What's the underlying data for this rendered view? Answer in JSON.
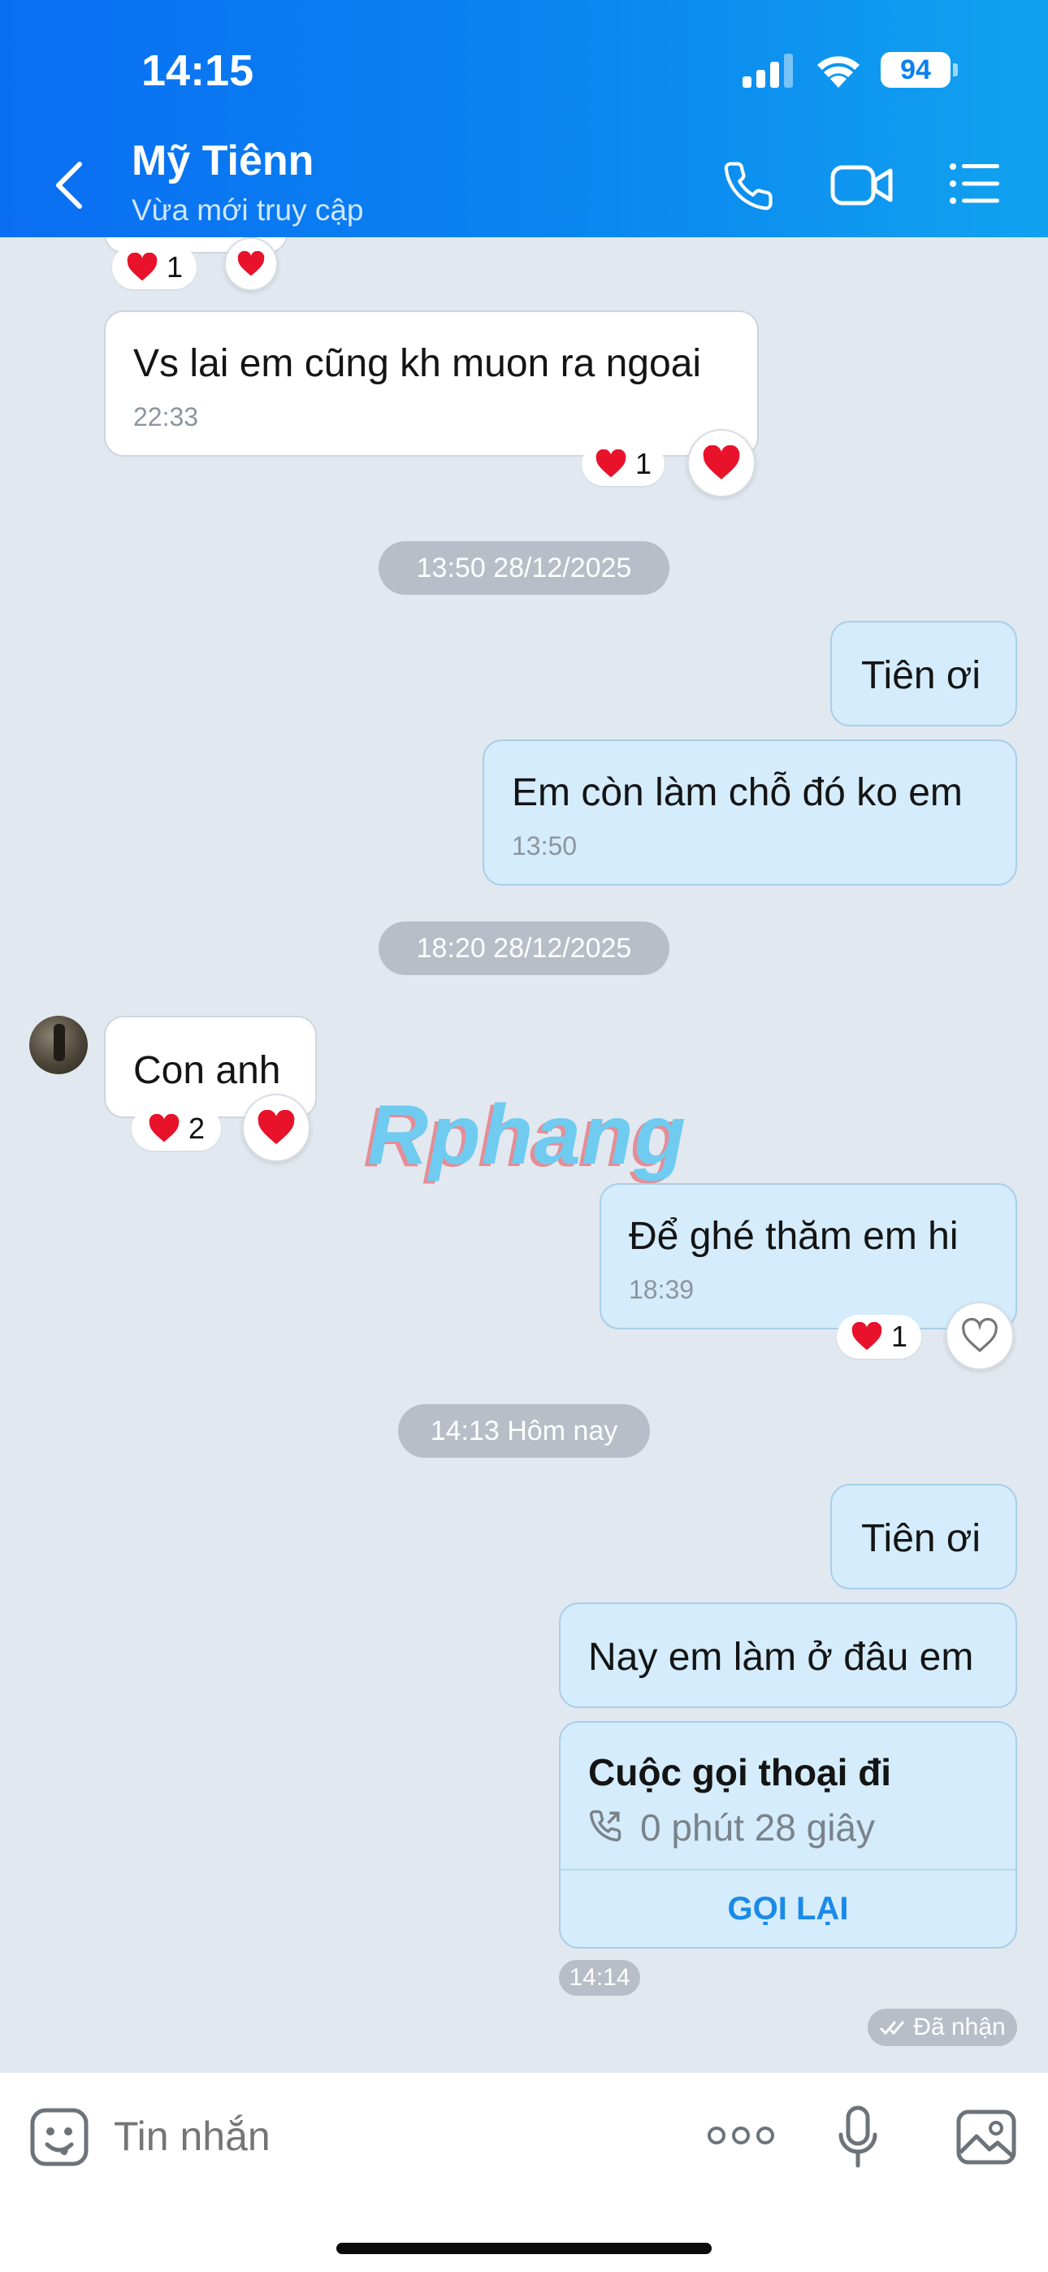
{
  "status_bar": {
    "time": "14:15",
    "battery": "94"
  },
  "header": {
    "name": "Mỹ Tiênn",
    "status": "Vừa mới truy cập"
  },
  "colors": {
    "header_start": "#0a6ef2",
    "header_end": "#11a2ef",
    "my_bubble": "#d4ecfb",
    "their_bubble": "#ffffff",
    "chat_bg": "#e2e8f0",
    "heart": "#e8122b",
    "accent": "#1a8ae8"
  },
  "icons": {
    "back": "chevron-left-icon",
    "call": "phone-icon",
    "video": "video-camera-icon",
    "menu": "list-menu-icon",
    "heart": "heart-icon",
    "emoji": "emoji-icon",
    "more": "more-dots-icon",
    "mic": "microphone-icon",
    "image": "image-icon"
  },
  "messages": {
    "top_reaction": {
      "count": "1"
    },
    "m1": {
      "text": "Vs lai em cũng kh muon ra ngoai",
      "time": "22:33",
      "reaction_count": "1"
    },
    "d1": "13:50 28/12/2025",
    "m2": {
      "text": "Tiên ơi"
    },
    "m3": {
      "text": "Em còn làm chỗ đó ko em",
      "time": "13:50"
    },
    "d2": "18:20 28/12/2025",
    "m4": {
      "text": "Con anh",
      "reaction_count": "2"
    },
    "m5": {
      "text": "Để  ghé thăm em hi",
      "time": "18:39",
      "reaction_count": "1"
    },
    "d3": "14:13 Hôm nay",
    "m6": {
      "text": "Tiên ơi"
    },
    "m7": {
      "text": "Nay em làm ở đâu em"
    },
    "call": {
      "title": "Cuộc gọi thoại đi",
      "duration": "0 phút 28 giây",
      "action": "GỌI LẠI",
      "time": "14:14"
    },
    "delivery_status": "Đã nhận"
  },
  "watermark": "Rphang",
  "composer": {
    "placeholder": "Tin nhắn"
  }
}
